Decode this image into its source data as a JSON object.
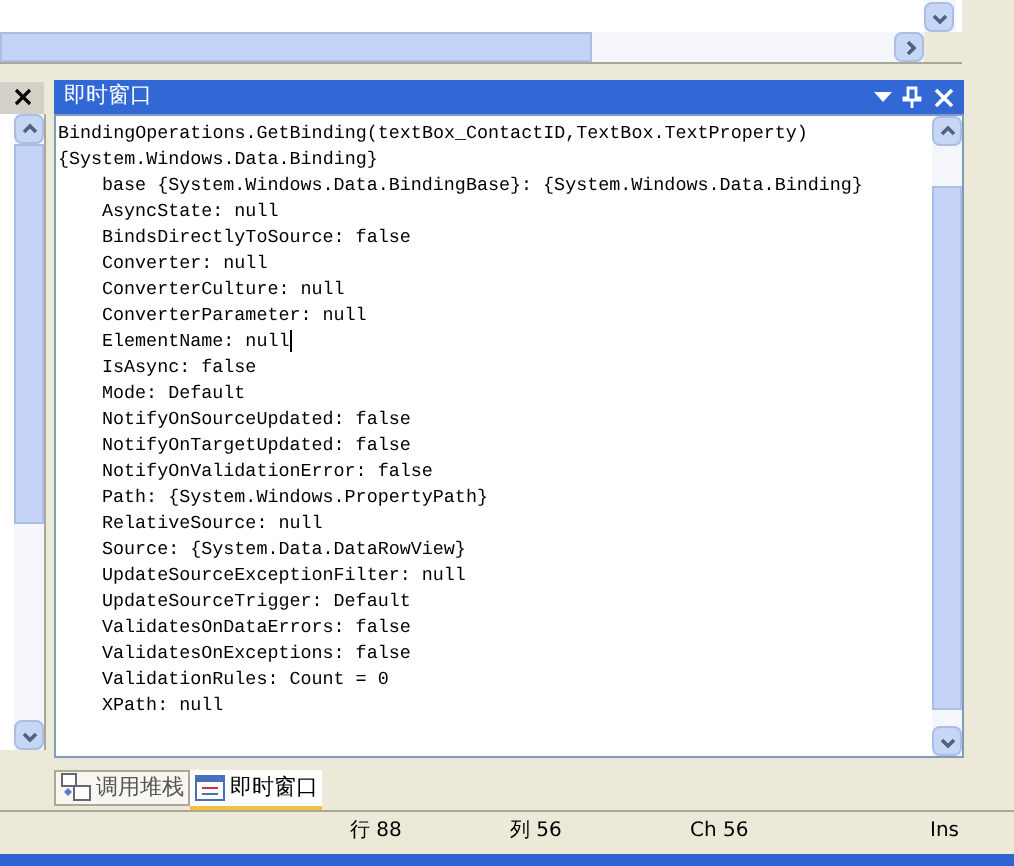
{
  "immediate_window": {
    "title": "即时窗口",
    "lines": [
      {
        "text": "BindingOperations.GetBinding(textBox_ContactID,TextBox.TextProperty)"
      },
      {
        "text": "{System.Windows.Data.Binding}",
        "children": [
          {
            "text": "base {System.Windows.Data.BindingBase}: {System.Windows.Data.Binding}"
          },
          {
            "text": "AsyncState: null"
          },
          {
            "text": "BindsDirectlyToSource: false"
          },
          {
            "text": "Converter: null"
          },
          {
            "text": "ConverterCulture: null"
          },
          {
            "text": "ConverterParameter: null"
          },
          {
            "text": "ElementName: null",
            "caret": true
          },
          {
            "text": "IsAsync: false"
          },
          {
            "text": "Mode: Default"
          },
          {
            "text": "NotifyOnSourceUpdated: false"
          },
          {
            "text": "NotifyOnTargetUpdated: false"
          },
          {
            "text": "NotifyOnValidationError: false"
          },
          {
            "text": "Path: {System.Windows.PropertyPath}"
          },
          {
            "text": "RelativeSource: null"
          },
          {
            "text": "Source: {System.Data.DataRowView}"
          },
          {
            "text": "UpdateSourceExceptionFilter: null"
          },
          {
            "text": "UpdateSourceTrigger: Default"
          },
          {
            "text": "ValidatesOnDataErrors: false"
          },
          {
            "text": "ValidatesOnExceptions: false"
          },
          {
            "text": "ValidationRules: Count = 0"
          },
          {
            "text": "XPath: null"
          }
        ]
      }
    ]
  },
  "tabs": [
    {
      "label": "调用堆栈",
      "selected": false
    },
    {
      "label": "即时窗口",
      "selected": true
    }
  ],
  "status_bar": [
    "行 88",
    "列 56",
    "Ch 56",
    "Ins"
  ]
}
